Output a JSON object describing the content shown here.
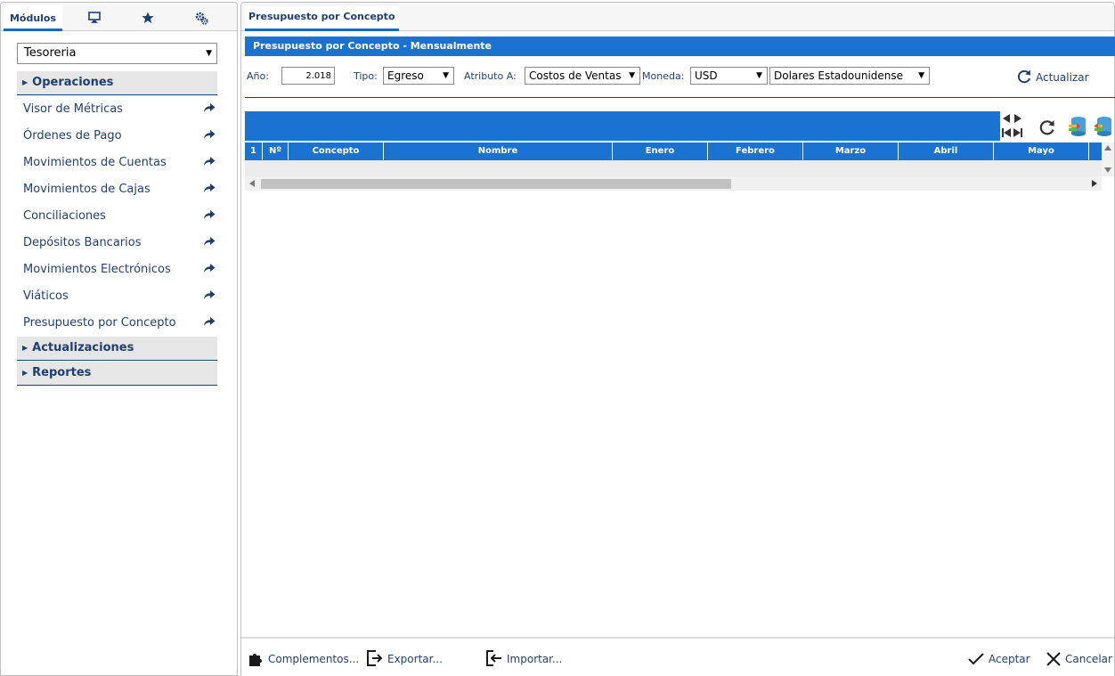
{
  "left_panel": {
    "tabs": {
      "modules_label": "Módulos",
      "desktop_icon": "desktop-icon",
      "favorites_icon": "star-icon",
      "settings_icon": "gears-icon"
    },
    "module_select": {
      "value": "Tesoreria"
    },
    "sections": [
      {
        "label": "Operaciones",
        "items": [
          "Visor de Métricas",
          "Órdenes de Pago",
          "Movimientos de Cuentas",
          "Movimientos de Cajas",
          "Conciliaciones",
          "Depósitos Bancarios",
          "Movimientos Electrónicos",
          "Viáticos",
          "Presupuesto por Concepto"
        ]
      },
      {
        "label": "Actualizaciones"
      },
      {
        "label": "Reportes"
      }
    ]
  },
  "right_panel": {
    "tab_label": "Presupuesto por Concepto",
    "panel_title": "Presupuesto por Concepto - Mensualmente",
    "filters": {
      "year_label": "Año:",
      "year_value": "2.018",
      "tipo_label": "Tipo:",
      "tipo_value": "Egreso",
      "atributo_label": "Atributo A:",
      "atributo_value": "Costos de Ventas",
      "moneda_label": "Moneda:",
      "moneda_code": "USD",
      "moneda_name": "Dolares Estadounidense",
      "refresh_label": "Actualizar"
    },
    "grid": {
      "columns": [
        "1",
        "Nº",
        "Concepto",
        "Nombre",
        "Enero",
        "Febrero",
        "Marzo",
        "Abril",
        "Mayo"
      ],
      "rows": []
    },
    "footer": {
      "complementos": "Complementos...",
      "exportar": "Exportar...",
      "importar": "Importar...",
      "aceptar": "Aceptar",
      "cancelar": "Cancelar"
    }
  },
  "colors": {
    "accent_blue": "#1a73d1",
    "text_navy": "#1f3f73",
    "section_gray": "#e6e6e6"
  }
}
